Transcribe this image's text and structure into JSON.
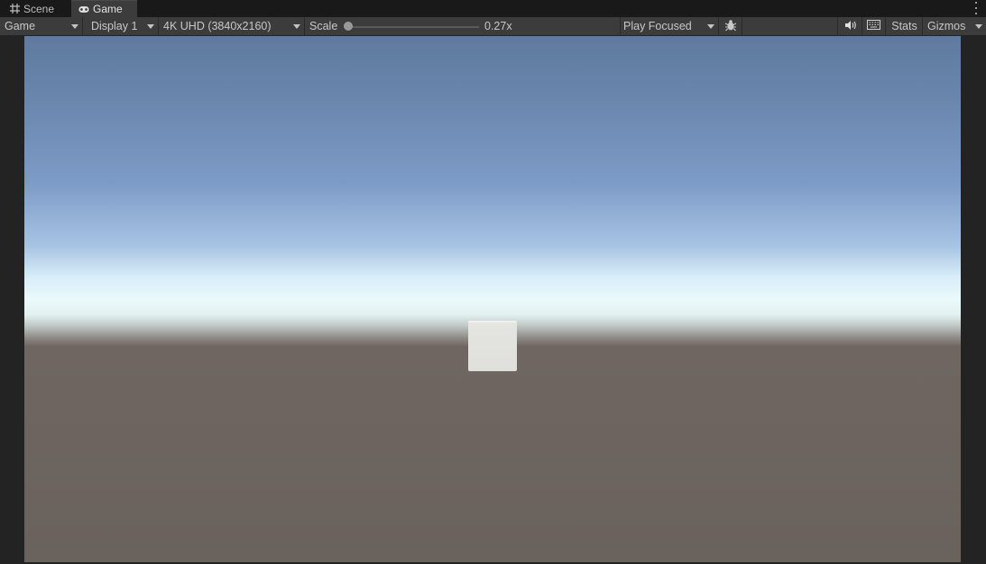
{
  "tabs": [
    {
      "label": "Scene",
      "icon": "grid-icon"
    },
    {
      "label": "Game",
      "icon": "gamepad-icon"
    }
  ],
  "toolbar": {
    "view_mode": "Game",
    "display": "Display 1",
    "resolution": "4K UHD (3840x2160)",
    "scale_label": "Scale",
    "scale_value": "0.27x",
    "play_mode": "Play Focused",
    "stats_label": "Stats",
    "gizmos_label": "Gizmos"
  },
  "icons": {
    "bug": "bug-icon",
    "audio": "speaker-icon",
    "keyboard": "keyboard-icon",
    "menu": "kebab-menu-icon"
  },
  "colors": {
    "panel": "#3c3c3c",
    "tab_bar": "#191919",
    "sky_top": "#5f7a9e",
    "horizon": "#eaf9fb",
    "ground": "#6a625d",
    "cube": "#e0e0dc"
  }
}
